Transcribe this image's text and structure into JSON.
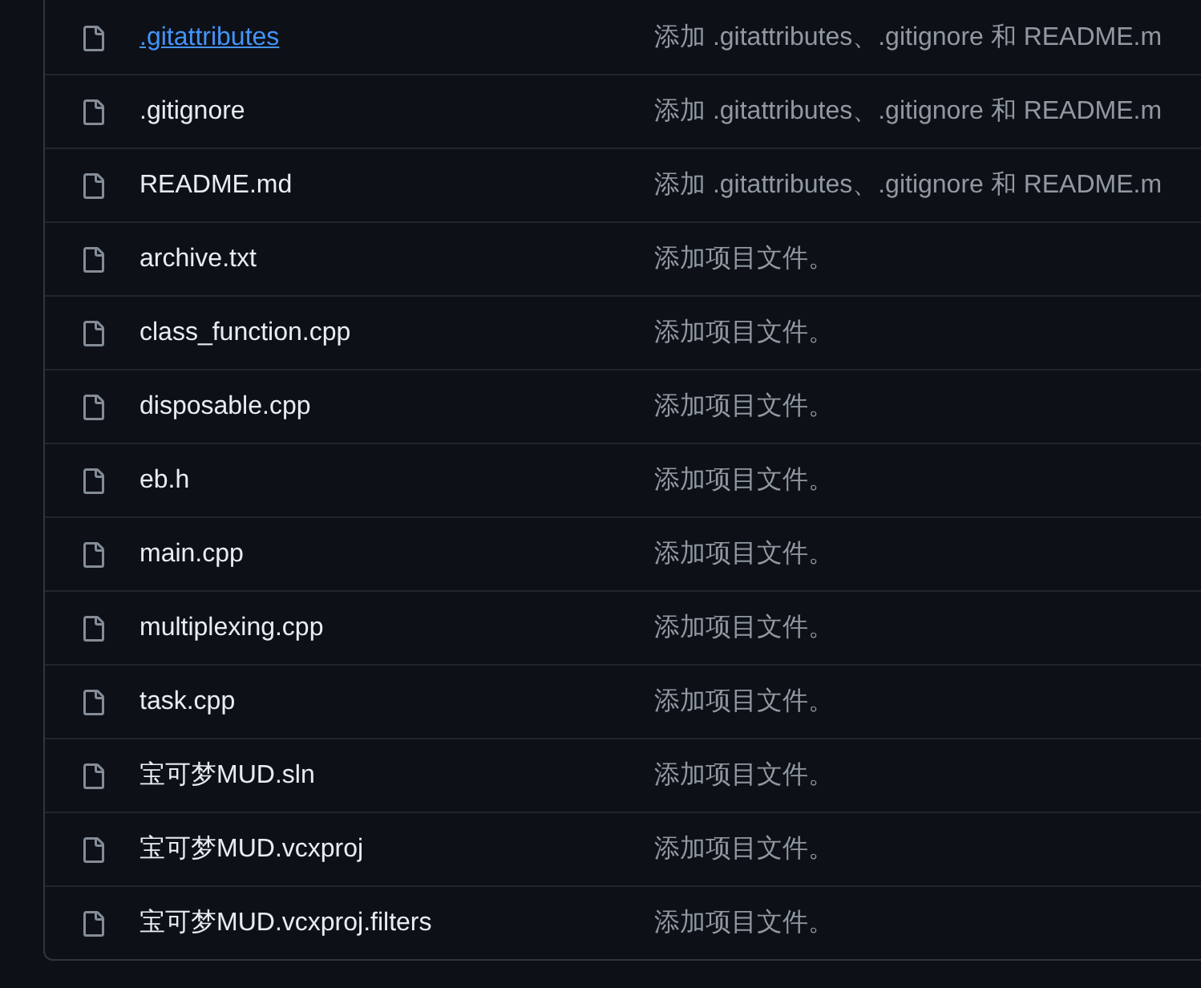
{
  "files": [
    {
      "name": ".gitattributes",
      "hovered": true,
      "message": "添加 .gitattributes、.gitignore 和 README.m"
    },
    {
      "name": ".gitignore",
      "hovered": false,
      "message": "添加 .gitattributes、.gitignore 和 README.m"
    },
    {
      "name": "README.md",
      "hovered": false,
      "message": "添加 .gitattributes、.gitignore 和 README.m"
    },
    {
      "name": "archive.txt",
      "hovered": false,
      "message": "添加项目文件。"
    },
    {
      "name": "class_function.cpp",
      "hovered": false,
      "message": "添加项目文件。"
    },
    {
      "name": "disposable.cpp",
      "hovered": false,
      "message": "添加项目文件。"
    },
    {
      "name": "eb.h",
      "hovered": false,
      "message": "添加项目文件。"
    },
    {
      "name": "main.cpp",
      "hovered": false,
      "message": "添加项目文件。"
    },
    {
      "name": "multiplexing.cpp",
      "hovered": false,
      "message": "添加项目文件。"
    },
    {
      "name": "task.cpp",
      "hovered": false,
      "message": "添加项目文件。"
    },
    {
      "name": "宝可梦MUD.sln",
      "hovered": false,
      "message": "添加项目文件。"
    },
    {
      "name": "宝可梦MUD.vcxproj",
      "hovered": false,
      "message": "添加项目文件。"
    },
    {
      "name": "宝可梦MUD.vcxproj.filters",
      "hovered": false,
      "message": "添加项目文件。"
    }
  ]
}
